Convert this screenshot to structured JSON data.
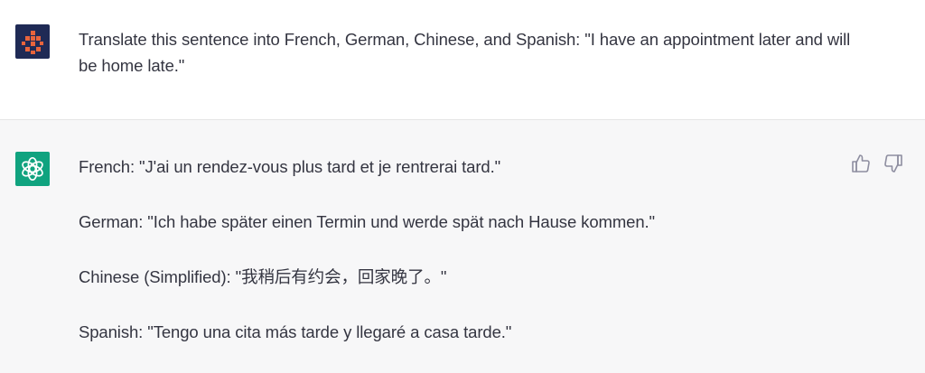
{
  "user_message": {
    "avatar_icon": "user-avatar-icon",
    "text": "Translate this sentence into French, German, Chinese, and Spanish: \"I have an appointment later and will be home late.\""
  },
  "assistant_message": {
    "avatar_icon": "openai-logo-icon",
    "lines": [
      "French: \"J'ai un rendez-vous plus tard et je rentrerai tard.\"",
      "German: \"Ich habe später einen Termin und werde spät nach Hause kommen.\"",
      "Chinese (Simplified): \"我稍后有约会，回家晚了。\"",
      "Spanish: \"Tengo una cita más tarde y llegaré a casa tarde.\""
    ],
    "feedback_icons": [
      "thumbs-up-icon",
      "thumbs-down-icon"
    ]
  },
  "colors": {
    "user_avatar_bg": "#1f2a55",
    "user_avatar_accent": "#e8643c",
    "assistant_avatar_bg": "#10a37f",
    "assistant_row_bg": "#f7f7f8",
    "text": "#343541"
  }
}
